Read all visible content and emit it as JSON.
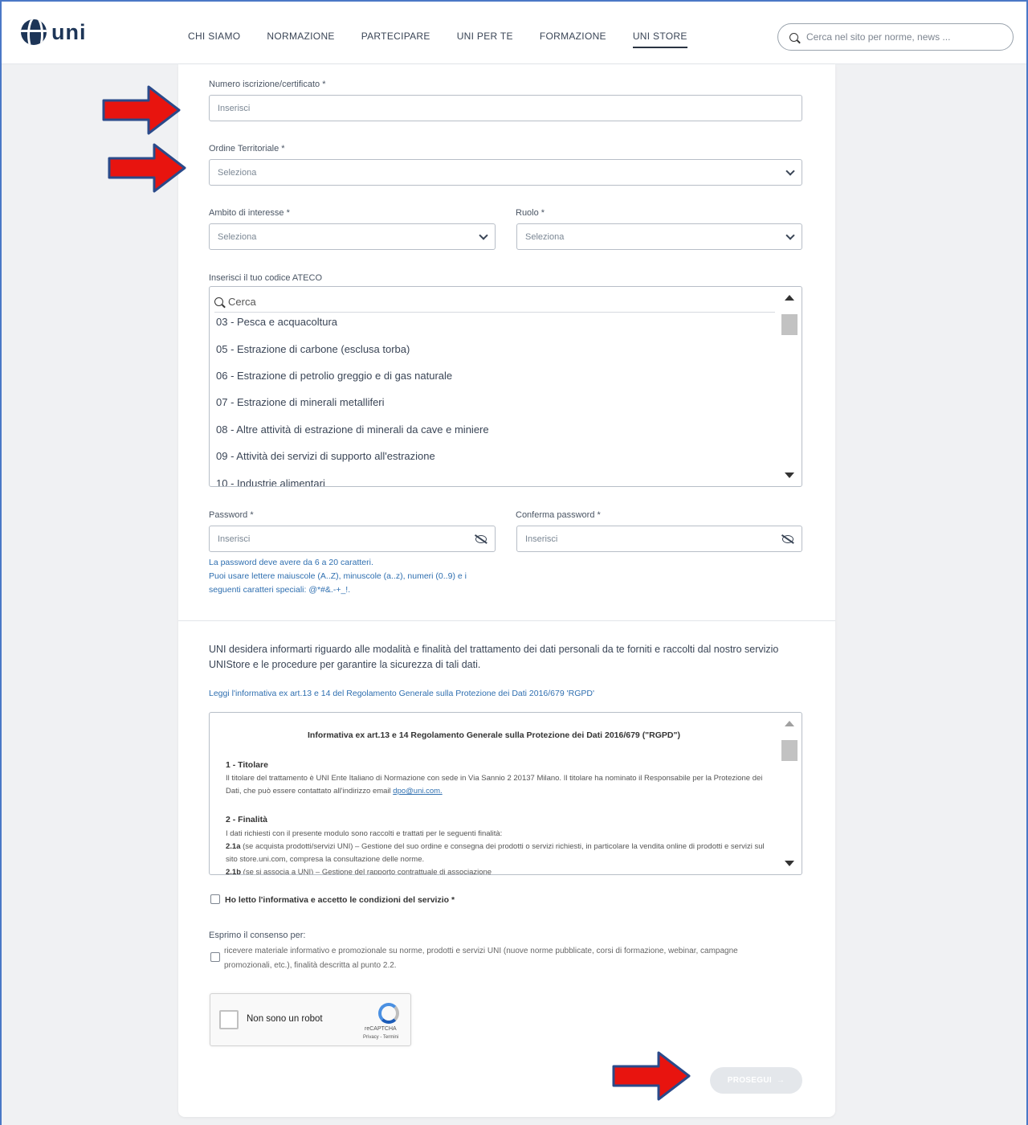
{
  "header": {
    "logo_text": "uni",
    "nav": [
      "CHI SIAMO",
      "NORMAZIONE",
      "PARTECIPARE",
      "UNI PER TE",
      "FORMAZIONE",
      "UNI STORE"
    ],
    "active_nav": "UNI STORE",
    "search_placeholder": "Cerca nel sito per norme, news ..."
  },
  "form": {
    "numero": {
      "label": "Numero iscrizione/certificato *",
      "placeholder": "Inserisci"
    },
    "ordine": {
      "label": "Ordine Territoriale *",
      "value": "Seleziona"
    },
    "ambito": {
      "label": "Ambito di interesse *",
      "value": "Seleziona"
    },
    "ruolo": {
      "label": "Ruolo *",
      "value": "Seleziona"
    },
    "ateco": {
      "label": "Inserisci il tuo codice ATECO",
      "search_placeholder": "Cerca",
      "items": [
        "03 - Pesca e acquacoltura",
        "05 - Estrazione di carbone (esclusa torba)",
        "06 - Estrazione di petrolio greggio e di gas naturale",
        "07 - Estrazione di minerali metalliferi",
        "08 - Altre attività di estrazione di minerali da cave e miniere",
        "09 - Attività dei servizi di supporto all'estrazione",
        "10 - Industrie alimentari"
      ]
    },
    "password": {
      "label": "Password *",
      "placeholder": "Inserisci"
    },
    "confirm_password": {
      "label": "Conferma password *",
      "placeholder": "Inserisci"
    },
    "password_hint": [
      "La password deve avere da 6 a 20 caratteri.",
      "Puoi usare lettere maiuscole (A..Z), minuscole (a..z), numeri (0..9) e i seguenti caratteri speciali: @*#&.-+_!."
    ]
  },
  "privacy": {
    "intro": "UNI desidera informarti riguardo alle modalità e finalità del trattamento dei dati personali da te forniti e raccolti dal nostro servizio UNIStore e le procedure per garantire la sicurezza di tali dati.",
    "link": "Leggi l'informativa ex art.13 e 14 del Regolamento Generale sulla Protezione dei Dati 2016/679 'RGPD'",
    "policy_title": "Informativa ex art.13 e 14  Regolamento Generale sulla Protezione dei Dati 2016/679 (\"RGPD\")",
    "s1_heading": "1 - Titolare",
    "s1_text": "Il titolare del trattamento è UNI Ente Italiano di Normazione con sede in Via Sannio 2 20137 Milano. Il titolare ha nominato il Responsabile per la Protezione dei Dati, che può essere contattato all'indirizzo email",
    "s1_email": "dpo@uni.com.",
    "s2_heading": "2 - Finalità",
    "s2_text": "I dati richiesti con il presente modulo sono raccolti e trattati per le seguenti finalità:",
    "s2_1a_label": "2.1a",
    "s2_1a_text": "(se acquista prodotti/servizi UNI) – Gestione del suo ordine e consegna dei prodotti o servizi richiesti, in particolare la vendita online di prodotti e servizi sul sito store.uni.com, compresa la consultazione delle norme.",
    "s2_1b_label": "2.1b",
    "s2_1b_text": "(se si associa a UNI) – Gestione del rapporto contrattuale di associazione",
    "accept_label": "Ho letto l'informativa e accetto le condizioni del servizio *",
    "consent_heading": "Esprimo il consenso per:",
    "consent_text": "ricevere materiale informativo e promozionale su norme, prodotti e servizi UNI (nuove norme pubblicate, corsi di formazione, webinar, campagne promozionali, etc.), finalità descritta al punto 2.2."
  },
  "recaptcha": {
    "label": "Non sono un robot",
    "brand": "reCAPTCHA",
    "terms": "Privacy - Termini"
  },
  "submit": {
    "label": "PROSEGUI",
    "arrow": "→"
  },
  "colors": {
    "annotation_arrow": "#e8140f",
    "annotation_outline": "#2a4a8a",
    "link": "#2f6fb0",
    "brand": "#1d3557"
  }
}
